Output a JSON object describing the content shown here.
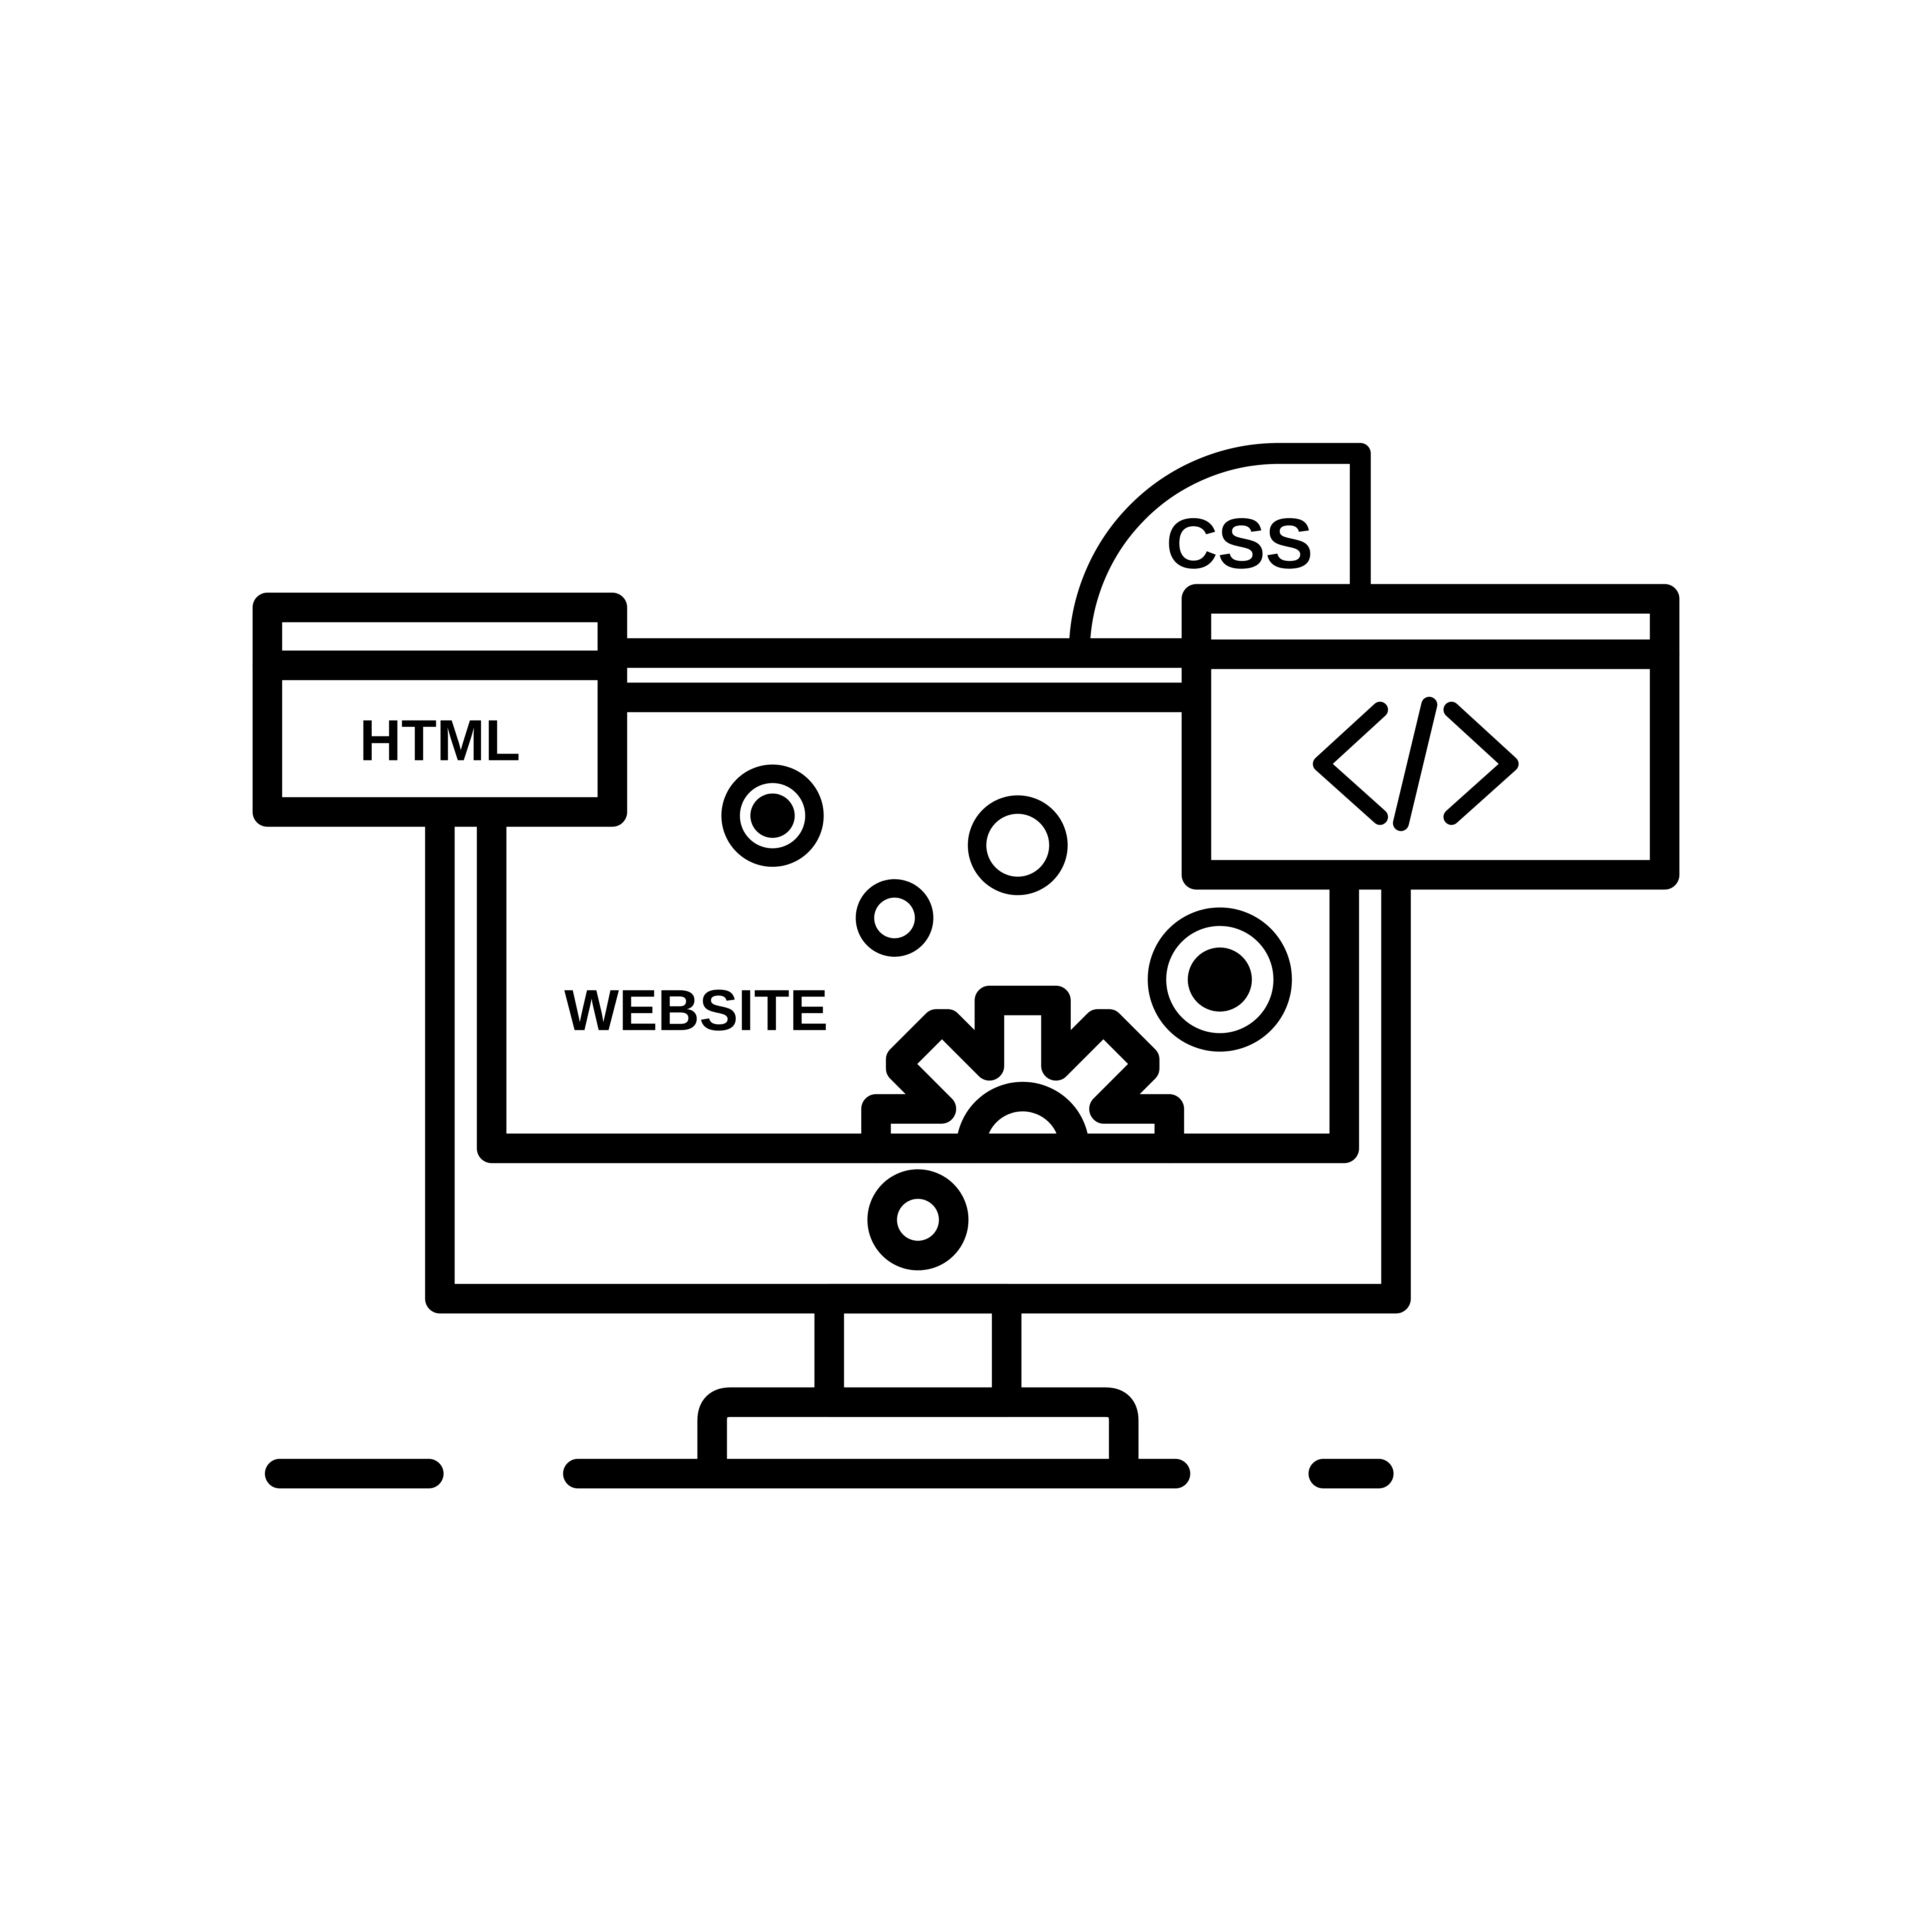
{
  "colors": {
    "stroke": "#000000",
    "background": "#ffffff"
  },
  "labels": {
    "html": "HTML",
    "css": "CSS",
    "website": "WEBSITE"
  },
  "icons": {
    "code": "code-brackets-icon",
    "gear": "gear-icon",
    "monitor": "desktop-monitor-icon"
  }
}
